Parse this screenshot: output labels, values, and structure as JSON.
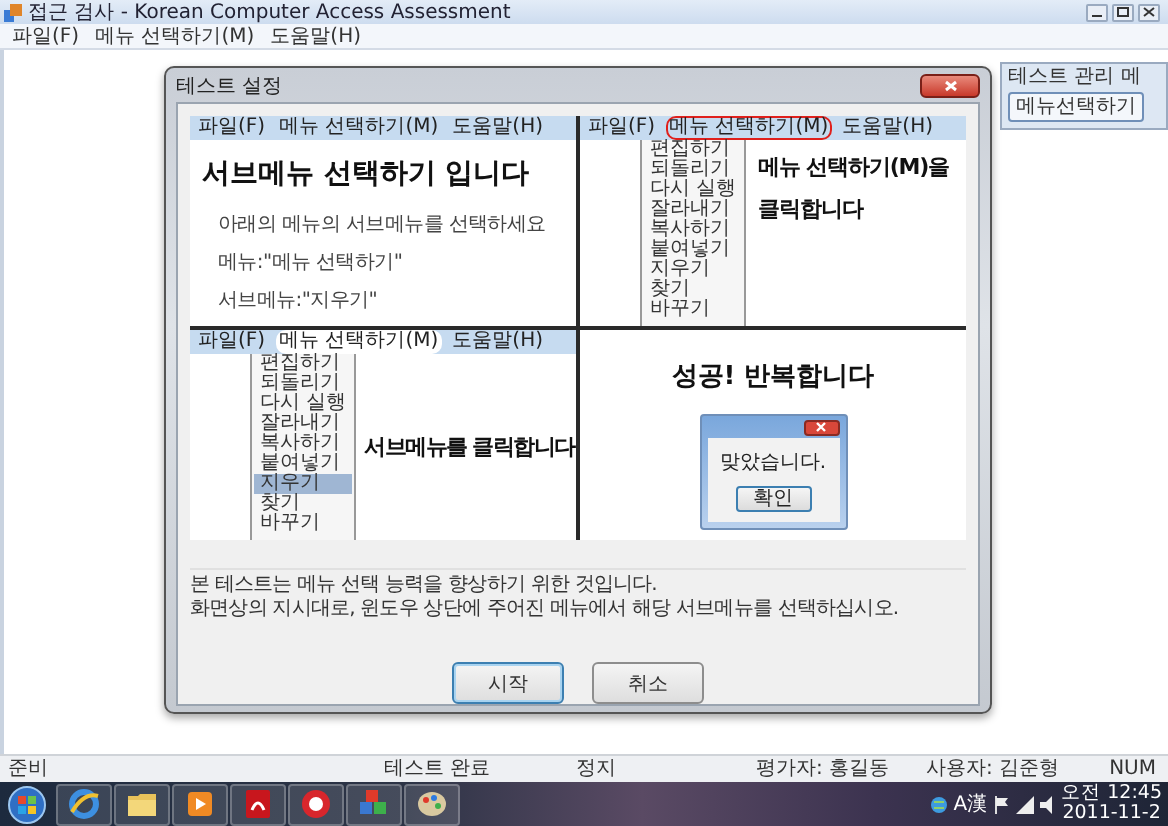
{
  "window": {
    "title": "접근 검사 - Korean Computer Access Assessment"
  },
  "menu_bar": [
    "파일(F)",
    "메뉴 선택하기(M)",
    "도움말(H)"
  ],
  "dialog": {
    "title": "테스트 설정",
    "panels": [
      {
        "kind": "instruction",
        "menu": [
          {
            "label": "파일(F)",
            "open": false,
            "circled": false
          },
          {
            "label": "메뉴 선택하기(M)",
            "open": false,
            "circled": false
          },
          {
            "label": "도움말(H)",
            "open": false,
            "circled": false
          }
        ],
        "heading_lines": [
          "서브메뉴 선택하기 입니다"
        ],
        "lines": [
          "아래의 메뉴의 서브메뉴를 선택하세요",
          "메뉴:\"메뉴 선택하기\"",
          "서브메뉴:\"지우기\""
        ]
      },
      {
        "kind": "menu",
        "menu": [
          {
            "label": "파일(F)",
            "open": false,
            "circled": false
          },
          {
            "label": "메뉴 선택하기(M)",
            "open": false,
            "circled": true
          },
          {
            "label": "도움말(H)",
            "open": false,
            "circled": false
          }
        ],
        "submenu": [
          {
            "label": "편집하기",
            "selected": false
          },
          {
            "label": "되돌리기",
            "selected": false
          },
          {
            "label": "다시 실행",
            "selected": false
          },
          {
            "label": "잘라내기",
            "selected": false
          },
          {
            "label": "복사하기",
            "selected": false
          },
          {
            "label": "붙여넣기",
            "selected": false
          },
          {
            "label": "지우기",
            "selected": false
          },
          {
            "label": "찾기",
            "selected": false
          },
          {
            "label": "바꾸기",
            "selected": false
          }
        ],
        "heading_lines": [
          "메뉴 선택하기(M)을",
          "클릭합니다"
        ]
      },
      {
        "kind": "menu",
        "menu": [
          {
            "label": "파일(F)",
            "open": false,
            "circled": false
          },
          {
            "label": "메뉴 선택하기(M)",
            "open": true,
            "circled": false
          },
          {
            "label": "도움말(H)",
            "open": false,
            "circled": false
          }
        ],
        "submenu": [
          {
            "label": "편집하기",
            "selected": false
          },
          {
            "label": "되돌리기",
            "selected": false
          },
          {
            "label": "다시 실행",
            "selected": false
          },
          {
            "label": "잘라내기",
            "selected": false
          },
          {
            "label": "복사하기",
            "selected": false
          },
          {
            "label": "붙여넣기",
            "selected": false
          },
          {
            "label": "지우기",
            "selected": true
          },
          {
            "label": "찾기",
            "selected": false
          },
          {
            "label": "바꾸기",
            "selected": false
          }
        ],
        "heading_lines": [
          "서브메뉴를 클릭합니다"
        ]
      },
      {
        "kind": "result",
        "heading_lines": [
          "성공! 반복합니다"
        ],
        "message_box": {
          "text": "맞았습니다.",
          "button": "확인"
        }
      }
    ],
    "description": [
      "본 테스트는 메뉴 선택 능력을 향상하기 위한 것입니다.",
      "화면상의 지시대로, 윈도우 상단에 주어진 메뉴에서 해당 서브메뉴를 선택하십시오."
    ],
    "buttons": [
      {
        "label": "시작",
        "focused": true
      },
      {
        "label": "취소",
        "focused": false
      }
    ]
  },
  "side_panel": {
    "title": "테스트 관리 메",
    "button": "메뉴선택하기"
  },
  "status_bar": [
    "준비",
    "테스트 완료",
    "정지",
    "평가자: 홍길동",
    "사용자: 김준형",
    "NUM"
  ],
  "taskbar": {
    "ime": "A漢",
    "time": "오전 12:45",
    "date": "2011-11-2"
  }
}
